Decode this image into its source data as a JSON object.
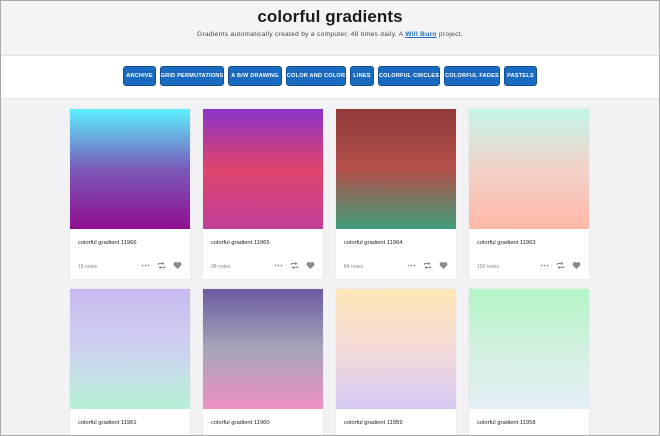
{
  "header": {
    "title": "colorful gradients",
    "tagline_prefix": "Gradients automatically created by a computer. 48 times daily. A",
    "tagline_link": "Will Burn",
    "tagline_suffix": "project."
  },
  "nav": [
    {
      "label": "ARCHIVE"
    },
    {
      "label": "GRID PERMUTATIONS"
    },
    {
      "label": "A B/W DRAWING"
    },
    {
      "label": "COLOR AND COLOR"
    },
    {
      "label": "LINES"
    },
    {
      "label": "COLORFUL CIRCLES"
    },
    {
      "label": "COLORFUL FADES"
    },
    {
      "label": "PASTELS"
    }
  ],
  "posts": [
    {
      "title": "colorful gradient 11966",
      "notes": "18 notes",
      "colors": [
        "#5cf0ff",
        "#7a5ab8",
        "#8f0e90"
      ]
    },
    {
      "title": "colorful gradient 11965",
      "notes": "98 notes",
      "colors": [
        "#8b33c9",
        "#e0446b",
        "#c03f98"
      ]
    },
    {
      "title": "colorful gradient 11964",
      "notes": "84 notes",
      "colors": [
        "#8e3a3a",
        "#b5504a",
        "#3f9e7a"
      ]
    },
    {
      "title": "colorful gradient 11963",
      "notes": "150 notes",
      "colors": [
        "#c2f6e8",
        "#f3d2c8",
        "#fdb8a8"
      ]
    },
    {
      "title": "colorful gradient 11961",
      "notes": "",
      "colors": [
        "#c8b9ee",
        "#cfd1f0",
        "#b4f2d6"
      ]
    },
    {
      "title": "colorful gradient 11960",
      "notes": "",
      "colors": [
        "#6d5aa0",
        "#a4a6b8",
        "#f08fc2"
      ]
    },
    {
      "title": "colorful gradient 11959",
      "notes": "",
      "colors": [
        "#fde6b4",
        "#f3dbd9",
        "#d6c8f3"
      ]
    },
    {
      "title": "colorful gradient 11958",
      "notes": "",
      "colors": [
        "#b2f5c5",
        "#d2f1e0",
        "#e4eef5"
      ]
    }
  ],
  "icons": {
    "more": "dots-icon",
    "reblog": "reblog-icon",
    "like": "heart-icon"
  },
  "colors": {
    "accent": "#1a6bbf",
    "page_bg": "#f2f2f4"
  }
}
